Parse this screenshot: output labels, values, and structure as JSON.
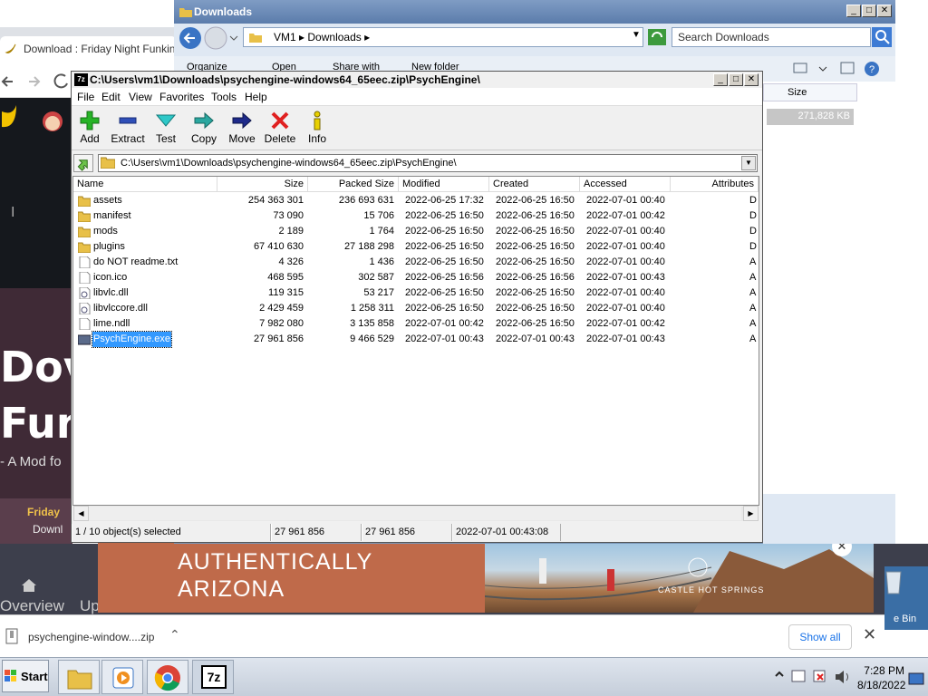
{
  "browser": {
    "tab_title": "Download : Friday Night Funkin' -",
    "hero_line1": "Dov",
    "hero_line2": "Fun",
    "hero_sub": "- A Mod fo",
    "feature_title": "Friday",
    "feature_download": "Downl",
    "nav_overview": "Overview",
    "nav_up": "Up",
    "ad": {
      "line1": "AUTHENTICALLY",
      "line2": "ARIZONA",
      "brand": "CASTLE HOT SPRINGS"
    },
    "download_bar": {
      "filename": "psychengine-window....zip",
      "show_all": "Show all"
    },
    "recycle_label": "e Bin"
  },
  "explorer": {
    "title": "Downloads",
    "address": [
      "VM1",
      "Downloads"
    ],
    "search_placeholder": "Search Downloads",
    "commands": [
      "Organize",
      "Open",
      "Share with",
      "New folder"
    ],
    "col_size": "Size",
    "size_value": "271,828 KB"
  },
  "sevenzip": {
    "title": "C:\\Users\\vm1\\Downloads\\psychengine-windows64_65eec.zip\\PsychEngine\\",
    "menu": [
      "File",
      "Edit",
      "View",
      "Favorites",
      "Tools",
      "Help"
    ],
    "toolbar": {
      "add": "Add",
      "extract": "Extract",
      "test": "Test",
      "copy": "Copy",
      "move": "Move",
      "delete": "Delete",
      "info": "Info"
    },
    "path": "C:\\Users\\vm1\\Downloads\\psychengine-windows64_65eec.zip\\PsychEngine\\",
    "columns": [
      "Name",
      "Size",
      "Packed Size",
      "Modified",
      "Created",
      "Accessed",
      "Attributes"
    ],
    "rows": [
      {
        "name": "assets",
        "type": "folder",
        "size": "254 363 301",
        "packed": "236 693 631",
        "modified": "2022-06-25 17:32",
        "created": "2022-06-25 16:50",
        "accessed": "2022-07-01 00:40",
        "attr": "D"
      },
      {
        "name": "manifest",
        "type": "folder",
        "size": "73 090",
        "packed": "15 706",
        "modified": "2022-06-25 16:50",
        "created": "2022-06-25 16:50",
        "accessed": "2022-07-01 00:42",
        "attr": "D"
      },
      {
        "name": "mods",
        "type": "folder",
        "size": "2 189",
        "packed": "1 764",
        "modified": "2022-06-25 16:50",
        "created": "2022-06-25 16:50",
        "accessed": "2022-07-01 00:40",
        "attr": "D"
      },
      {
        "name": "plugins",
        "type": "folder",
        "size": "67 410 630",
        "packed": "27 188 298",
        "modified": "2022-06-25 16:50",
        "created": "2022-06-25 16:50",
        "accessed": "2022-07-01 00:40",
        "attr": "D"
      },
      {
        "name": "do NOT readme.txt",
        "type": "file",
        "size": "4 326",
        "packed": "1 436",
        "modified": "2022-06-25 16:50",
        "created": "2022-06-25 16:50",
        "accessed": "2022-07-01 00:40",
        "attr": "A"
      },
      {
        "name": "icon.ico",
        "type": "file",
        "size": "468 595",
        "packed": "302 587",
        "modified": "2022-06-25 16:56",
        "created": "2022-06-25 16:56",
        "accessed": "2022-07-01 00:43",
        "attr": "A"
      },
      {
        "name": "libvlc.dll",
        "type": "dll",
        "size": "119 315",
        "packed": "53 217",
        "modified": "2022-06-25 16:50",
        "created": "2022-06-25 16:50",
        "accessed": "2022-07-01 00:40",
        "attr": "A"
      },
      {
        "name": "libvlccore.dll",
        "type": "dll",
        "size": "2 429 459",
        "packed": "1 258 311",
        "modified": "2022-06-25 16:50",
        "created": "2022-06-25 16:50",
        "accessed": "2022-07-01 00:40",
        "attr": "A"
      },
      {
        "name": "lime.ndll",
        "type": "file",
        "size": "7 982 080",
        "packed": "3 135 858",
        "modified": "2022-07-01 00:42",
        "created": "2022-06-25 16:50",
        "accessed": "2022-07-01 00:42",
        "attr": "A"
      },
      {
        "name": "PsychEngine.exe",
        "type": "exe",
        "size": "27 961 856",
        "packed": "9 466 529",
        "modified": "2022-07-01 00:43",
        "created": "2022-07-01 00:43",
        "accessed": "2022-07-01 00:43",
        "attr": "A",
        "selected": true
      }
    ],
    "status": {
      "selection": "1 / 10 object(s) selected",
      "size": "27 961 856",
      "packed": "27 961 856",
      "modified": "2022-07-01 00:43:08"
    }
  },
  "taskbar": {
    "start_label": "Start",
    "sevenzip_label": "7z",
    "time": "7:28 PM",
    "date": "8/18/2022"
  },
  "colors": {
    "selection": "#3399ff",
    "folder": "#e8c048",
    "taskbar": "#c5ceda"
  }
}
